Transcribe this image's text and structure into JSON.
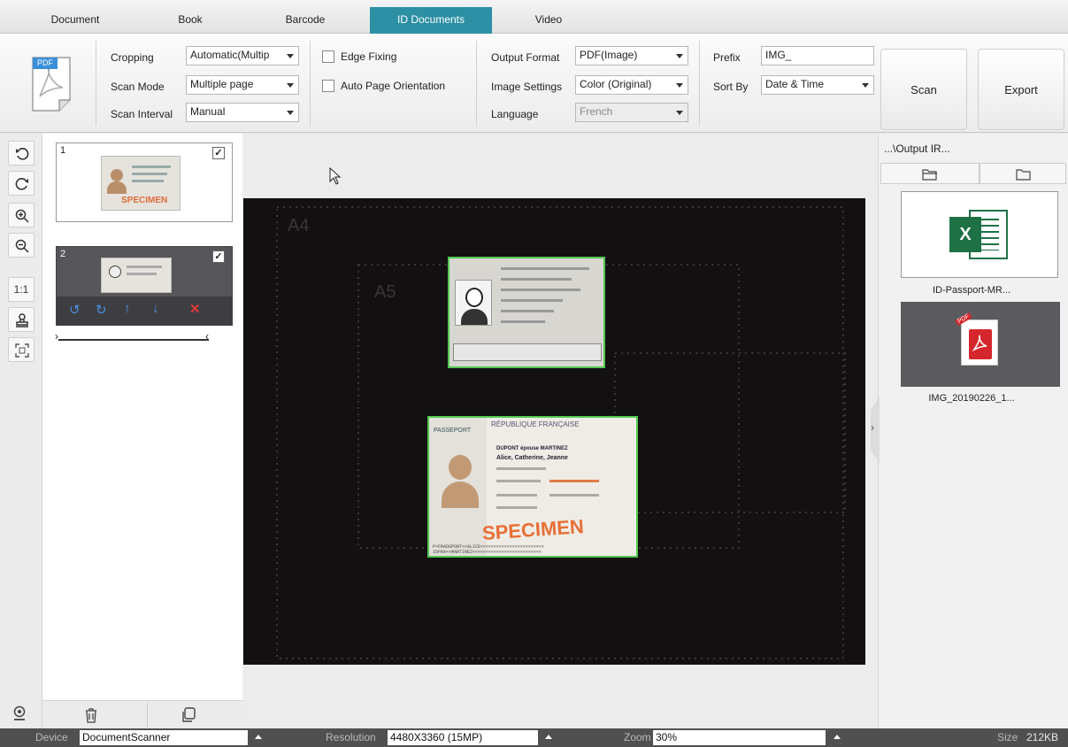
{
  "tabs": [
    "Document",
    "Book",
    "Barcode",
    "ID Documents",
    "Video"
  ],
  "ribbon": {
    "format_icon_text": "PDF",
    "cropping": {
      "label": "Cropping",
      "value": "Automatic(Multip"
    },
    "scan_mode": {
      "label": "Scan Mode",
      "value": "Multiple page"
    },
    "scan_interval": {
      "label": "Scan Interval",
      "value": "Manual"
    },
    "edge_fixing": {
      "label": "Edge Fixing",
      "checked": false
    },
    "auto_page_orientation": {
      "label": "Auto Page Orientation",
      "checked": false
    },
    "output_format": {
      "label": "Output Format",
      "value": "PDF(Image)"
    },
    "image_settings": {
      "label": "Image Settings",
      "value": "Color (Original)"
    },
    "language": {
      "label": "Language",
      "value": "French"
    },
    "prefix": {
      "label": "Prefix",
      "value": "IMG_"
    },
    "sort_by": {
      "label": "Sort By",
      "value": "Date & Time"
    },
    "scan_button": "Scan",
    "export_button": "Export"
  },
  "left_tools": [
    "rotate-left-icon",
    "rotate-right-icon",
    "zoom-in-icon",
    "zoom-out-icon",
    "actual-size",
    "stamp-icon",
    "fit-screen-icon"
  ],
  "left_tools_text": {
    "actual_size": "1:1"
  },
  "thumbnails": [
    {
      "number": "1",
      "checked": true,
      "stamp": "SPECIMEN"
    },
    {
      "number": "2",
      "checked": true
    }
  ],
  "canvas": {
    "paper_labels": [
      "A4",
      "A5"
    ],
    "passport_header": "PASSEPORT",
    "republic": "RÉPUBLIQUE FRANÇAISE",
    "passport_name": "DUPONT épouse MARTINEZ",
    "passport_given": "Alice, Catherine, Jeanne",
    "specimen": "SPECIMEN",
    "mrz_1": "P<FRADUPONT<<ALICE<<<<<<<<<<<<<<<<<<<<<<<<",
    "mrz_2": "IDFRA<<MARTINEZ<<<<<<<<<<<<<<<<<<<<<<<<<<"
  },
  "right_panel": {
    "path": "...\\Output IR...",
    "files": [
      {
        "name": "ID-Passport-MR...",
        "type": "excel-icon",
        "icon_text": "X"
      },
      {
        "name": "IMG_20190226_1...",
        "type": "pdf-icon",
        "icon_text": "PDF"
      }
    ],
    "collapse_arrow": "›"
  },
  "statusbar": {
    "device_label": "Device",
    "device_value": "DocumentScanner",
    "resolution_label": "Resolution",
    "resolution_value": "4480X3360 (15MP)",
    "zoom_label": "Zoom",
    "zoom_value": "30%",
    "size_label": "Size",
    "size_value": "212KB"
  },
  "colors": {
    "accent": "#2c8fa3",
    "crop_border": "#4fc94f",
    "statusbar": "#505050",
    "canvas_bg": "#131012"
  }
}
